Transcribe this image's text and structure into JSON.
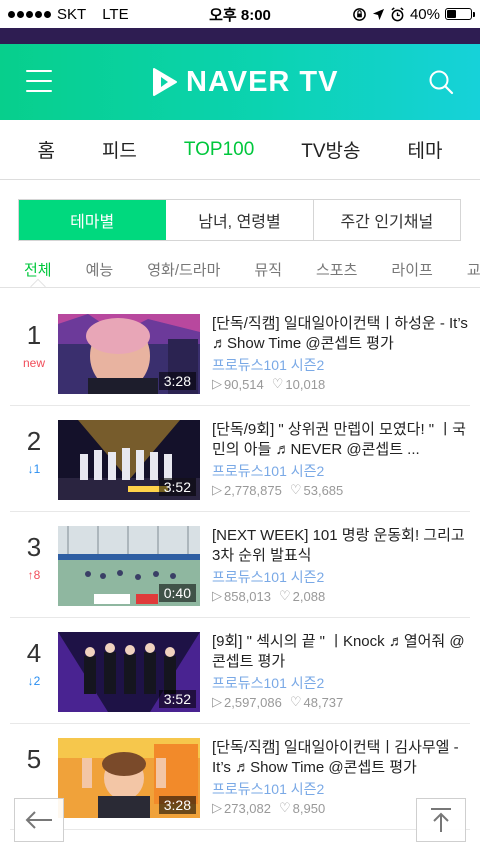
{
  "status_bar": {
    "carrier": "SKT",
    "network": "LTE",
    "time": "오후 8:00",
    "battery": "40%",
    "battery_level": 0.4
  },
  "header": {
    "logo_text": "NAVER TV"
  },
  "main_tabs": [
    "홈",
    "피드",
    "TOP100",
    "TV방송",
    "테마"
  ],
  "segments": [
    "테마별",
    "남녀, 연령별",
    "주간 인기채널"
  ],
  "categories": [
    "전체",
    "예능",
    "영화/드라마",
    "뮤직",
    "스포츠",
    "라이프",
    "교"
  ],
  "videos": [
    {
      "rank": "1",
      "change": "new",
      "change_type": "new",
      "title": "[단독/직캠] 일대일아이컨택ㅣ하성운 - It’s ♬Show Time @콘셉트 평가",
      "channel": "프로듀스101 시즌2",
      "views": "90,514",
      "likes": "10,018",
      "duration": "3:28"
    },
    {
      "rank": "2",
      "change": "↓1",
      "change_type": "down",
      "title": "[단독/9회] \" 상위권 만렙이 모였다! \" ㅣ국민의 아들 ♬NEVER @콘셉트 ...",
      "channel": "프로듀스101 시즌2",
      "views": "2,778,875",
      "likes": "53,685",
      "duration": "3:52"
    },
    {
      "rank": "3",
      "change": "↑8",
      "change_type": "up",
      "title": "[NEXT WEEK] 101 명랑 운동회! 그리고 3차 순위 발표식",
      "channel": "프로듀스101 시즌2",
      "views": "858,013",
      "likes": "2,088",
      "duration": "0:40"
    },
    {
      "rank": "4",
      "change": "↓2",
      "change_type": "down",
      "title": "[9회] \" 섹시의 끝 \" ㅣKnock ♬열어줘 @콘셉트 평가",
      "channel": "프로듀스101 시즌2",
      "views": "2,597,086",
      "likes": "48,737",
      "duration": "3:52"
    },
    {
      "rank": "5",
      "change": "",
      "change_type": "up",
      "title": "[단독/직캠] 일대일아이컨택ㅣ김사무엘 - It’s ♬Show Time @콘셉트 평가",
      "channel": "프로듀스101 시즌2",
      "views": "273,082",
      "likes": "8,950",
      "duration": "3:28"
    }
  ],
  "colors": {
    "accent": "#00c73c",
    "header_start": "#07cf8c",
    "header_end": "#16d2d9",
    "down": "#2a8ef0",
    "up": "#f04d5a"
  }
}
